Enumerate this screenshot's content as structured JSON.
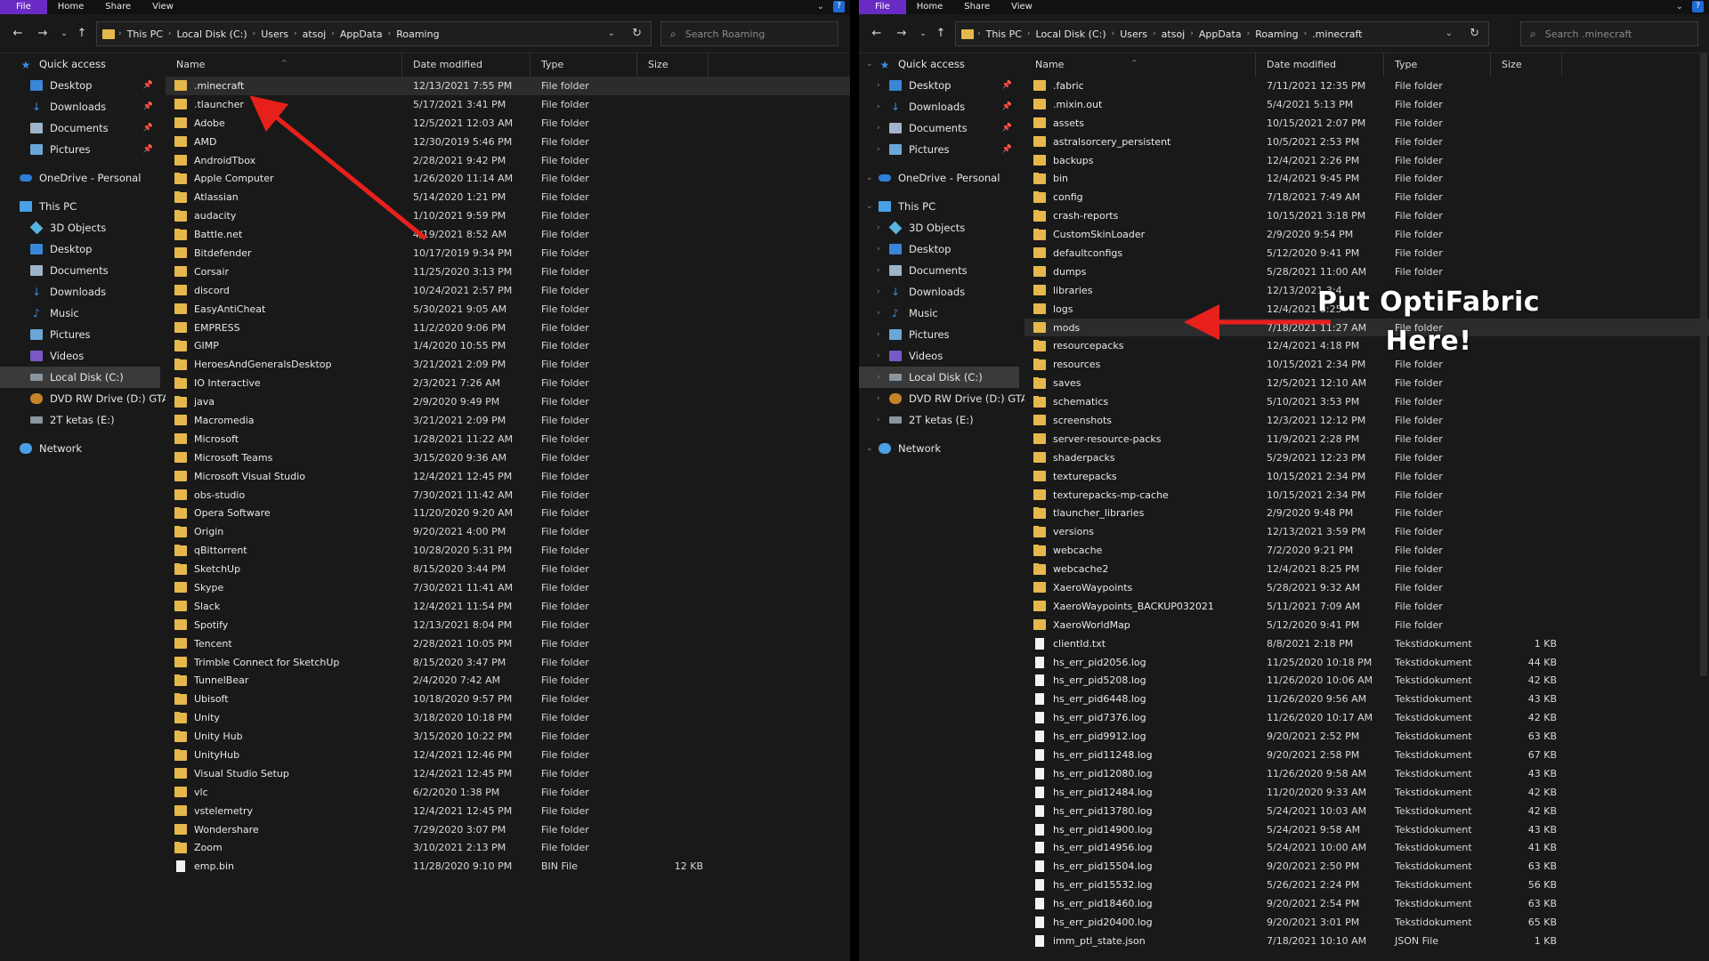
{
  "ribbon": {
    "tabs": [
      "File",
      "Home",
      "Share",
      "View"
    ],
    "expand": "⌄",
    "help": "?"
  },
  "left": {
    "breadcrumb": [
      "This PC",
      "Local Disk (C:)",
      "Users",
      "atsoj",
      "AppData",
      "Roaming"
    ],
    "search_placeholder": "Search Roaming",
    "nav": [
      {
        "label": "Quick access",
        "icon": "star-icon",
        "pin": false
      },
      {
        "label": "Desktop",
        "icon": "desktop-icon",
        "pin": true
      },
      {
        "label": "Downloads",
        "icon": "download-icon",
        "pin": true
      },
      {
        "label": "Documents",
        "icon": "documents-icon",
        "pin": true
      },
      {
        "label": "Pictures",
        "icon": "pictures-icon",
        "pin": true
      },
      {
        "label": "",
        "icon": "",
        "pin": false
      },
      {
        "label": "OneDrive - Personal",
        "icon": "cloud-icon",
        "pin": false
      },
      {
        "label": "",
        "icon": "",
        "pin": false
      },
      {
        "label": "This PC",
        "icon": "computer-icon",
        "pin": false
      },
      {
        "label": "3D Objects",
        "icon": "cube-icon",
        "pin": false
      },
      {
        "label": "Desktop",
        "icon": "desktop-icon",
        "pin": false
      },
      {
        "label": "Documents",
        "icon": "documents-icon",
        "pin": false
      },
      {
        "label": "Downloads",
        "icon": "download-icon",
        "pin": false
      },
      {
        "label": "Music",
        "icon": "music-icon",
        "pin": false
      },
      {
        "label": "Pictures",
        "icon": "pictures-icon",
        "pin": false
      },
      {
        "label": "Videos",
        "icon": "videos-icon",
        "pin": false
      },
      {
        "label": "Local Disk (C:)",
        "icon": "disk-icon",
        "pin": false,
        "selected": true
      },
      {
        "label": "DVD RW Drive (D:) GTA",
        "icon": "dvd-icon",
        "pin": false
      },
      {
        "label": "2T ketas (E:)",
        "icon": "disk-icon",
        "pin": false
      },
      {
        "label": "",
        "icon": "",
        "pin": false
      },
      {
        "label": "Network",
        "icon": "network-icon",
        "pin": false
      }
    ],
    "columns": {
      "name": "Name",
      "date": "Date modified",
      "type": "Type",
      "size": "Size"
    },
    "rows": [
      {
        "name": ".minecraft",
        "date": "12/13/2021 7:55 PM",
        "type": "File folder",
        "size": "",
        "hl": true
      },
      {
        "name": ".tlauncher",
        "date": "5/17/2021 3:41 PM",
        "type": "File folder",
        "size": ""
      },
      {
        "name": "Adobe",
        "date": "12/5/2021 12:03 AM",
        "type": "File folder",
        "size": ""
      },
      {
        "name": "AMD",
        "date": "12/30/2019 5:46 PM",
        "type": "File folder",
        "size": ""
      },
      {
        "name": "AndroidTbox",
        "date": "2/28/2021 9:42 PM",
        "type": "File folder",
        "size": ""
      },
      {
        "name": "Apple Computer",
        "date": "1/26/2020 11:14 AM",
        "type": "File folder",
        "size": ""
      },
      {
        "name": "Atlassian",
        "date": "5/14/2020 1:21 PM",
        "type": "File folder",
        "size": ""
      },
      {
        "name": "audacity",
        "date": "1/10/2021 9:59 PM",
        "type": "File folder",
        "size": ""
      },
      {
        "name": "Battle.net",
        "date": "4/19/2021 8:52 AM",
        "type": "File folder",
        "size": ""
      },
      {
        "name": "Bitdefender",
        "date": "10/17/2019 9:34 PM",
        "type": "File folder",
        "size": ""
      },
      {
        "name": "Corsair",
        "date": "11/25/2020 3:13 PM",
        "type": "File folder",
        "size": ""
      },
      {
        "name": "discord",
        "date": "10/24/2021 2:57 PM",
        "type": "File folder",
        "size": ""
      },
      {
        "name": "EasyAntiCheat",
        "date": "5/30/2021 9:05 AM",
        "type": "File folder",
        "size": ""
      },
      {
        "name": "EMPRESS",
        "date": "11/2/2020 9:06 PM",
        "type": "File folder",
        "size": ""
      },
      {
        "name": "GIMP",
        "date": "1/4/2020 10:55 PM",
        "type": "File folder",
        "size": ""
      },
      {
        "name": "HeroesAndGeneralsDesktop",
        "date": "3/21/2021 2:09 PM",
        "type": "File folder",
        "size": ""
      },
      {
        "name": "IO Interactive",
        "date": "2/3/2021 7:26 AM",
        "type": "File folder",
        "size": ""
      },
      {
        "name": "java",
        "date": "2/9/2020 9:49 PM",
        "type": "File folder",
        "size": ""
      },
      {
        "name": "Macromedia",
        "date": "3/21/2021 2:09 PM",
        "type": "File folder",
        "size": ""
      },
      {
        "name": "Microsoft",
        "date": "1/28/2021 11:22 AM",
        "type": "File folder",
        "size": ""
      },
      {
        "name": "Microsoft Teams",
        "date": "3/15/2020 9:36 AM",
        "type": "File folder",
        "size": ""
      },
      {
        "name": "Microsoft Visual Studio",
        "date": "12/4/2021 12:45 PM",
        "type": "File folder",
        "size": ""
      },
      {
        "name": "obs-studio",
        "date": "7/30/2021 11:42 AM",
        "type": "File folder",
        "size": ""
      },
      {
        "name": "Opera Software",
        "date": "11/20/2020 9:20 AM",
        "type": "File folder",
        "size": ""
      },
      {
        "name": "Origin",
        "date": "9/20/2021 4:00 PM",
        "type": "File folder",
        "size": ""
      },
      {
        "name": "qBittorrent",
        "date": "10/28/2020 5:31 PM",
        "type": "File folder",
        "size": ""
      },
      {
        "name": "SketchUp",
        "date": "8/15/2020 3:44 PM",
        "type": "File folder",
        "size": ""
      },
      {
        "name": "Skype",
        "date": "7/30/2021 11:41 AM",
        "type": "File folder",
        "size": ""
      },
      {
        "name": "Slack",
        "date": "12/4/2021 11:54 PM",
        "type": "File folder",
        "size": ""
      },
      {
        "name": "Spotify",
        "date": "12/13/2021 8:04 PM",
        "type": "File folder",
        "size": ""
      },
      {
        "name": "Tencent",
        "date": "2/28/2021 10:05 PM",
        "type": "File folder",
        "size": ""
      },
      {
        "name": "Trimble Connect for SketchUp",
        "date": "8/15/2020 3:47 PM",
        "type": "File folder",
        "size": ""
      },
      {
        "name": "TunnelBear",
        "date": "2/4/2020 7:42 AM",
        "type": "File folder",
        "size": ""
      },
      {
        "name": "Ubisoft",
        "date": "10/18/2020 9:57 PM",
        "type": "File folder",
        "size": ""
      },
      {
        "name": "Unity",
        "date": "3/18/2020 10:18 PM",
        "type": "File folder",
        "size": ""
      },
      {
        "name": "Unity Hub",
        "date": "3/15/2020 10:22 PM",
        "type": "File folder",
        "size": ""
      },
      {
        "name": "UnityHub",
        "date": "12/4/2021 12:46 PM",
        "type": "File folder",
        "size": ""
      },
      {
        "name": "Visual Studio Setup",
        "date": "12/4/2021 12:45 PM",
        "type": "File folder",
        "size": ""
      },
      {
        "name": "vlc",
        "date": "6/2/2020 1:38 PM",
        "type": "File folder",
        "size": ""
      },
      {
        "name": "vstelemetry",
        "date": "12/4/2021 12:45 PM",
        "type": "File folder",
        "size": ""
      },
      {
        "name": "Wondershare",
        "date": "7/29/2020 3:07 PM",
        "type": "File folder",
        "size": ""
      },
      {
        "name": "Zoom",
        "date": "3/10/2021 2:13 PM",
        "type": "File folder",
        "size": ""
      },
      {
        "name": "emp.bin",
        "date": "11/28/2020 9:10 PM",
        "type": "BIN File",
        "size": "12 KB",
        "file": true
      }
    ]
  },
  "right": {
    "breadcrumb": [
      "This PC",
      "Local Disk (C:)",
      "Users",
      "atsoj",
      "AppData",
      "Roaming",
      ".minecraft"
    ],
    "search_placeholder": "Search .minecraft",
    "nav": [
      {
        "label": "Quick access",
        "icon": "star-icon",
        "pin": false
      },
      {
        "label": "Desktop",
        "icon": "desktop-icon",
        "pin": true
      },
      {
        "label": "Downloads",
        "icon": "download-icon",
        "pin": true
      },
      {
        "label": "Documents",
        "icon": "documents-icon",
        "pin": true
      },
      {
        "label": "Pictures",
        "icon": "pictures-icon",
        "pin": true
      },
      {
        "label": "",
        "icon": "",
        "pin": false
      },
      {
        "label": "OneDrive - Personal",
        "icon": "cloud-icon",
        "pin": false
      },
      {
        "label": "",
        "icon": "",
        "pin": false
      },
      {
        "label": "This PC",
        "icon": "computer-icon",
        "pin": false
      },
      {
        "label": "3D Objects",
        "icon": "cube-icon",
        "pin": false
      },
      {
        "label": "Desktop",
        "icon": "desktop-icon",
        "pin": false
      },
      {
        "label": "Documents",
        "icon": "documents-icon",
        "pin": false
      },
      {
        "label": "Downloads",
        "icon": "download-icon",
        "pin": false
      },
      {
        "label": "Music",
        "icon": "music-icon",
        "pin": false
      },
      {
        "label": "Pictures",
        "icon": "pictures-icon",
        "pin": false
      },
      {
        "label": "Videos",
        "icon": "videos-icon",
        "pin": false
      },
      {
        "label": "Local Disk (C:)",
        "icon": "disk-icon",
        "pin": false,
        "selected": true
      },
      {
        "label": "DVD RW Drive (D:) GTA",
        "icon": "dvd-icon",
        "pin": false
      },
      {
        "label": "2T ketas (E:)",
        "icon": "disk-icon",
        "pin": false
      },
      {
        "label": "",
        "icon": "",
        "pin": false
      },
      {
        "label": "Network",
        "icon": "network-icon",
        "pin": false
      }
    ],
    "columns": {
      "name": "Name",
      "date": "Date modified",
      "type": "Type",
      "size": "Size"
    },
    "rows": [
      {
        "name": ".fabric",
        "date": "7/11/2021 12:35 PM",
        "type": "File folder",
        "size": ""
      },
      {
        "name": ".mixin.out",
        "date": "5/4/2021 5:13 PM",
        "type": "File folder",
        "size": ""
      },
      {
        "name": "assets",
        "date": "10/15/2021 2:07 PM",
        "type": "File folder",
        "size": ""
      },
      {
        "name": "astralsorcery_persistent",
        "date": "10/5/2021 2:53 PM",
        "type": "File folder",
        "size": ""
      },
      {
        "name": "backups",
        "date": "12/4/2021 2:26 PM",
        "type": "File folder",
        "size": ""
      },
      {
        "name": "bin",
        "date": "12/4/2021 9:45 PM",
        "type": "File folder",
        "size": ""
      },
      {
        "name": "config",
        "date": "7/18/2021 7:49 AM",
        "type": "File folder",
        "size": ""
      },
      {
        "name": "crash-reports",
        "date": "10/15/2021 3:18 PM",
        "type": "File folder",
        "size": ""
      },
      {
        "name": "CustomSkinLoader",
        "date": "2/9/2020 9:54 PM",
        "type": "File folder",
        "size": ""
      },
      {
        "name": "defaultconfigs",
        "date": "5/12/2020 9:41 PM",
        "type": "File folder",
        "size": ""
      },
      {
        "name": "dumps",
        "date": "5/28/2021 11:00 AM",
        "type": "File folder",
        "size": ""
      },
      {
        "name": "libraries",
        "date": "12/13/2021 3:4",
        "type": "",
        "size": ""
      },
      {
        "name": "logs",
        "date": "12/4/2021 8:25",
        "type": "",
        "size": ""
      },
      {
        "name": "mods",
        "date": "7/18/2021 11:27 AM",
        "type": "File folder",
        "size": "",
        "hl": true
      },
      {
        "name": "resourcepacks",
        "date": "12/4/2021 4:18 PM",
        "type": "",
        "size": ""
      },
      {
        "name": "resources",
        "date": "10/15/2021 2:34 PM",
        "type": "File folder",
        "size": ""
      },
      {
        "name": "saves",
        "date": "12/5/2021 12:10 AM",
        "type": "File folder",
        "size": ""
      },
      {
        "name": "schematics",
        "date": "5/10/2021 3:53 PM",
        "type": "File folder",
        "size": ""
      },
      {
        "name": "screenshots",
        "date": "12/3/2021 12:12 PM",
        "type": "File folder",
        "size": ""
      },
      {
        "name": "server-resource-packs",
        "date": "11/9/2021 2:28 PM",
        "type": "File folder",
        "size": ""
      },
      {
        "name": "shaderpacks",
        "date": "5/29/2021 12:23 PM",
        "type": "File folder",
        "size": ""
      },
      {
        "name": "texturepacks",
        "date": "10/15/2021 2:34 PM",
        "type": "File folder",
        "size": ""
      },
      {
        "name": "texturepacks-mp-cache",
        "date": "10/15/2021 2:34 PM",
        "type": "File folder",
        "size": ""
      },
      {
        "name": "tlauncher_libraries",
        "date": "2/9/2020 9:48 PM",
        "type": "File folder",
        "size": ""
      },
      {
        "name": "versions",
        "date": "12/13/2021 3:59 PM",
        "type": "File folder",
        "size": ""
      },
      {
        "name": "webcache",
        "date": "7/2/2020 9:21 PM",
        "type": "File folder",
        "size": ""
      },
      {
        "name": "webcache2",
        "date": "12/4/2021 8:25 PM",
        "type": "File folder",
        "size": ""
      },
      {
        "name": "XaeroWaypoints",
        "date": "5/28/2021 9:32 AM",
        "type": "File folder",
        "size": ""
      },
      {
        "name": "XaeroWaypoints_BACKUP032021",
        "date": "5/11/2021 7:09 AM",
        "type": "File folder",
        "size": ""
      },
      {
        "name": "XaeroWorldMap",
        "date": "5/12/2020 9:41 PM",
        "type": "File folder",
        "size": ""
      },
      {
        "name": "clientId.txt",
        "date": "8/8/2021 2:18 PM",
        "type": "Tekstidokument",
        "size": "1 KB",
        "file": true
      },
      {
        "name": "hs_err_pid2056.log",
        "date": "11/25/2020 10:18 PM",
        "type": "Tekstidokument",
        "size": "44 KB",
        "file": true
      },
      {
        "name": "hs_err_pid5208.log",
        "date": "11/26/2020 10:06 AM",
        "type": "Tekstidokument",
        "size": "42 KB",
        "file": true
      },
      {
        "name": "hs_err_pid6448.log",
        "date": "11/26/2020 9:56 AM",
        "type": "Tekstidokument",
        "size": "43 KB",
        "file": true
      },
      {
        "name": "hs_err_pid7376.log",
        "date": "11/26/2020 10:17 AM",
        "type": "Tekstidokument",
        "size": "42 KB",
        "file": true
      },
      {
        "name": "hs_err_pid9912.log",
        "date": "9/20/2021 2:52 PM",
        "type": "Tekstidokument",
        "size": "63 KB",
        "file": true
      },
      {
        "name": "hs_err_pid11248.log",
        "date": "9/20/2021 2:58 PM",
        "type": "Tekstidokument",
        "size": "67 KB",
        "file": true
      },
      {
        "name": "hs_err_pid12080.log",
        "date": "11/26/2020 9:58 AM",
        "type": "Tekstidokument",
        "size": "43 KB",
        "file": true
      },
      {
        "name": "hs_err_pid12484.log",
        "date": "11/20/2020 9:33 AM",
        "type": "Tekstidokument",
        "size": "42 KB",
        "file": true
      },
      {
        "name": "hs_err_pid13780.log",
        "date": "5/24/2021 10:03 AM",
        "type": "Tekstidokument",
        "size": "42 KB",
        "file": true
      },
      {
        "name": "hs_err_pid14900.log",
        "date": "5/24/2021 9:58 AM",
        "type": "Tekstidokument",
        "size": "43 KB",
        "file": true
      },
      {
        "name": "hs_err_pid14956.log",
        "date": "5/24/2021 10:00 AM",
        "type": "Tekstidokument",
        "size": "41 KB",
        "file": true
      },
      {
        "name": "hs_err_pid15504.log",
        "date": "9/20/2021 2:50 PM",
        "type": "Tekstidokument",
        "size": "63 KB",
        "file": true
      },
      {
        "name": "hs_err_pid15532.log",
        "date": "5/26/2021 2:24 PM",
        "type": "Tekstidokument",
        "size": "56 KB",
        "file": true
      },
      {
        "name": "hs_err_pid18460.log",
        "date": "9/20/2021 2:54 PM",
        "type": "Tekstidokument",
        "size": "63 KB",
        "file": true
      },
      {
        "name": "hs_err_pid20400.log",
        "date": "9/20/2021 3:01 PM",
        "type": "Tekstidokument",
        "size": "65 KB",
        "file": true
      },
      {
        "name": "imm_ptl_state.json",
        "date": "7/18/2021 10:10 AM",
        "type": "JSON File",
        "size": "1 KB",
        "file": true
      }
    ]
  },
  "annotation": {
    "text_line1": "Put OptiFabric",
    "text_line2": "Here!",
    "arrow_color": "#e8201c"
  }
}
